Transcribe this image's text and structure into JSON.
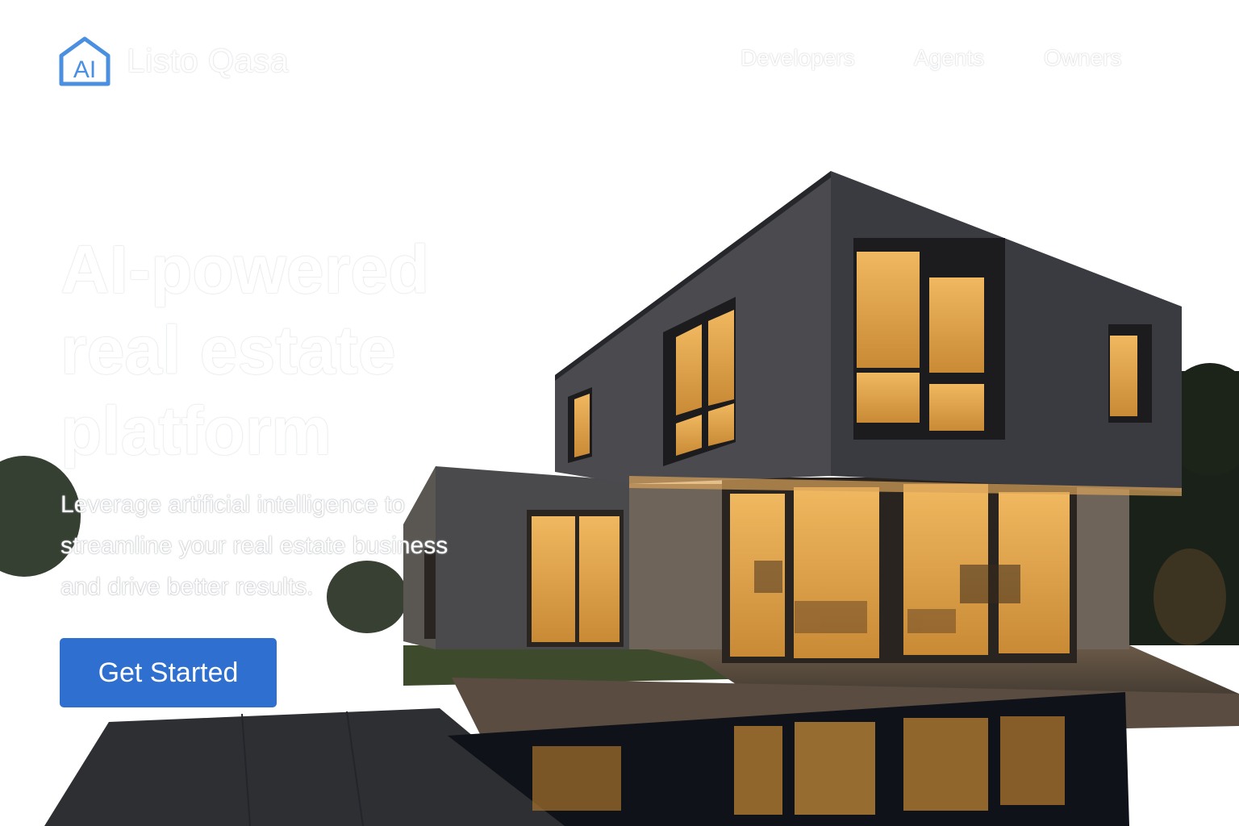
{
  "header": {
    "logo_text": "AI",
    "brand_name": "Listo Qasa",
    "nav": [
      "Developers",
      "Agents",
      "Owners"
    ]
  },
  "hero": {
    "title_lines": [
      "AI-powered",
      "real estate",
      "platform"
    ],
    "subtitle_lines": [
      "Leverage artificial intelligence to",
      "streamline your real estate business",
      "and drive better results."
    ],
    "cta_label": "Get Started"
  },
  "colors": {
    "accent": "#2f6fcf",
    "logo": "#4a8fe0",
    "house_wall": "#3f4147",
    "window_glow": "#e2a347",
    "pool": "#0f1218"
  }
}
